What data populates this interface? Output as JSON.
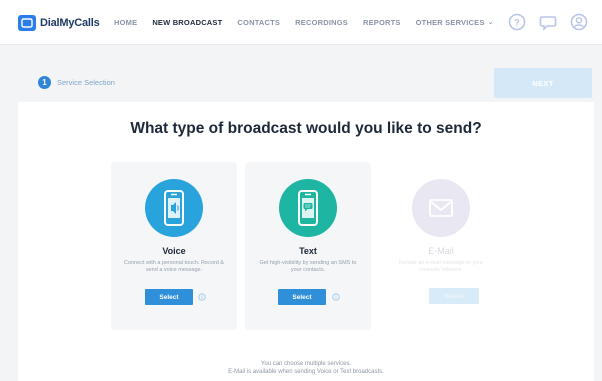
{
  "app": {
    "brand": "DialMyCalls"
  },
  "nav": {
    "items": [
      {
        "label": "HOME",
        "active": false
      },
      {
        "label": "NEW BROADCAST",
        "active": true
      },
      {
        "label": "CONTACTS",
        "active": false
      },
      {
        "label": "RECORDINGS",
        "active": false
      },
      {
        "label": "REPORTS",
        "active": false
      },
      {
        "label": "OTHER SERVICES",
        "active": false,
        "has_dropdown": true
      }
    ],
    "icons": [
      "help-icon",
      "chat-icon",
      "account-icon"
    ]
  },
  "step": {
    "number": "1",
    "label": "Service Selection",
    "next_label": "NEXT"
  },
  "main": {
    "headline": "What type of broadcast would you like to send?",
    "cards": [
      {
        "id": "voice",
        "title": "Voice",
        "description": "Connect with a personal touch. Record & send a voice message.",
        "select_label": "Select",
        "color": "#29a3db",
        "enabled": true
      },
      {
        "id": "text",
        "title": "Text",
        "description": "Get high-visibility by sending an SMS to your contacts.",
        "select_label": "Select",
        "color": "#1eb6a2",
        "enabled": true
      },
      {
        "id": "email",
        "title": "E-Mail",
        "description": "Include an e-mail message to your contacts' inboxes.",
        "select_label": "Select",
        "color": "#e9e7f2",
        "enabled": false
      }
    ],
    "footnote_line1": "You can choose multiple services.",
    "footnote_line2": "E-Mail is available when sending Voice or Text broadcasts."
  },
  "colors": {
    "accent": "#2f8fd8",
    "voice": "#29a3db",
    "text": "#1eb6a2",
    "headline": "#1d2838"
  }
}
